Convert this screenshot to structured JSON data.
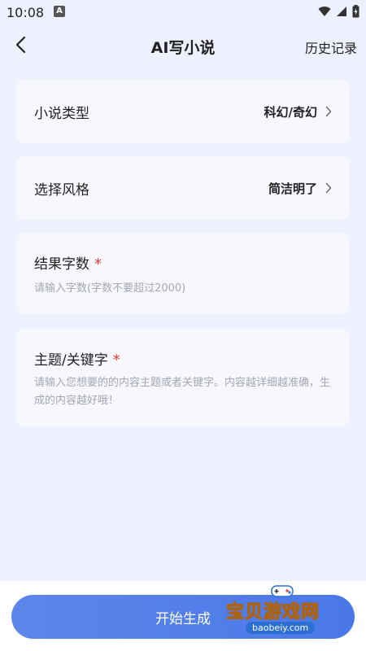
{
  "status_bar": {
    "time": "10:08",
    "notification_letter": "A"
  },
  "nav": {
    "title": "AI写小说",
    "history": "历史记录"
  },
  "novel_type": {
    "label": "小说类型",
    "value": "科幻/奇幻"
  },
  "style": {
    "label": "选择风格",
    "value": "简洁明了"
  },
  "word_count": {
    "label": "结果字数",
    "required_mark": "*",
    "placeholder": "请输入字数(字数不要超过2000)"
  },
  "topic": {
    "label": "主题/关键字",
    "required_mark": "*",
    "placeholder": "请输入您想要的的内容主题或者关键字。内容越详细越准确，生成的内容越好哦！"
  },
  "action": {
    "start_label": "开始生成"
  },
  "watermark": {
    "text": "宝贝游戏网",
    "url": "baobeiy.com"
  },
  "colors": {
    "accent": "#4a78e8",
    "background": "#edf0fd",
    "required": "#e23b3b"
  }
}
